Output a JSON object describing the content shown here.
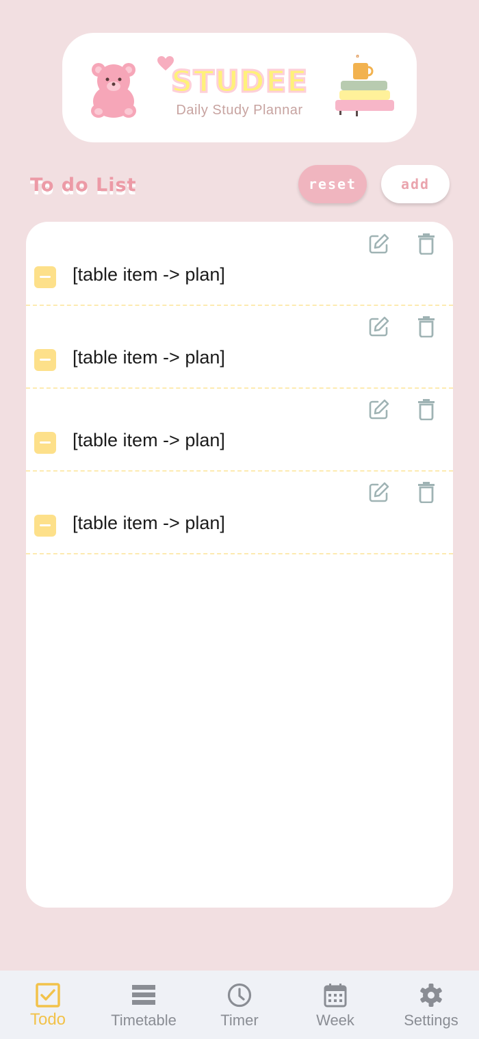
{
  "header": {
    "logo_title": "STUDEE",
    "logo_subtitle": "Daily Study Plannar"
  },
  "todo": {
    "title": "To do List",
    "reset_label": "reset",
    "add_label": "add",
    "items": [
      {
        "text": "[table item -> plan]"
      },
      {
        "text": "[table item -> plan]"
      },
      {
        "text": "[table item -> plan]"
      },
      {
        "text": "[table item -> plan]"
      }
    ]
  },
  "nav": {
    "items": [
      {
        "label": "Todo",
        "icon": "checkbox-icon",
        "active": true
      },
      {
        "label": "Timetable",
        "icon": "list-icon",
        "active": false
      },
      {
        "label": "Timer",
        "icon": "clock-icon",
        "active": false
      },
      {
        "label": "Week",
        "icon": "calendar-icon",
        "active": false
      },
      {
        "label": "Settings",
        "icon": "gear-icon",
        "active": false
      }
    ]
  },
  "colors": {
    "background": "#f2dfe1",
    "accent_pink": "#f0b5bf",
    "accent_yellow": "#f2c24a",
    "icon_gray": "#9fb3b4"
  }
}
